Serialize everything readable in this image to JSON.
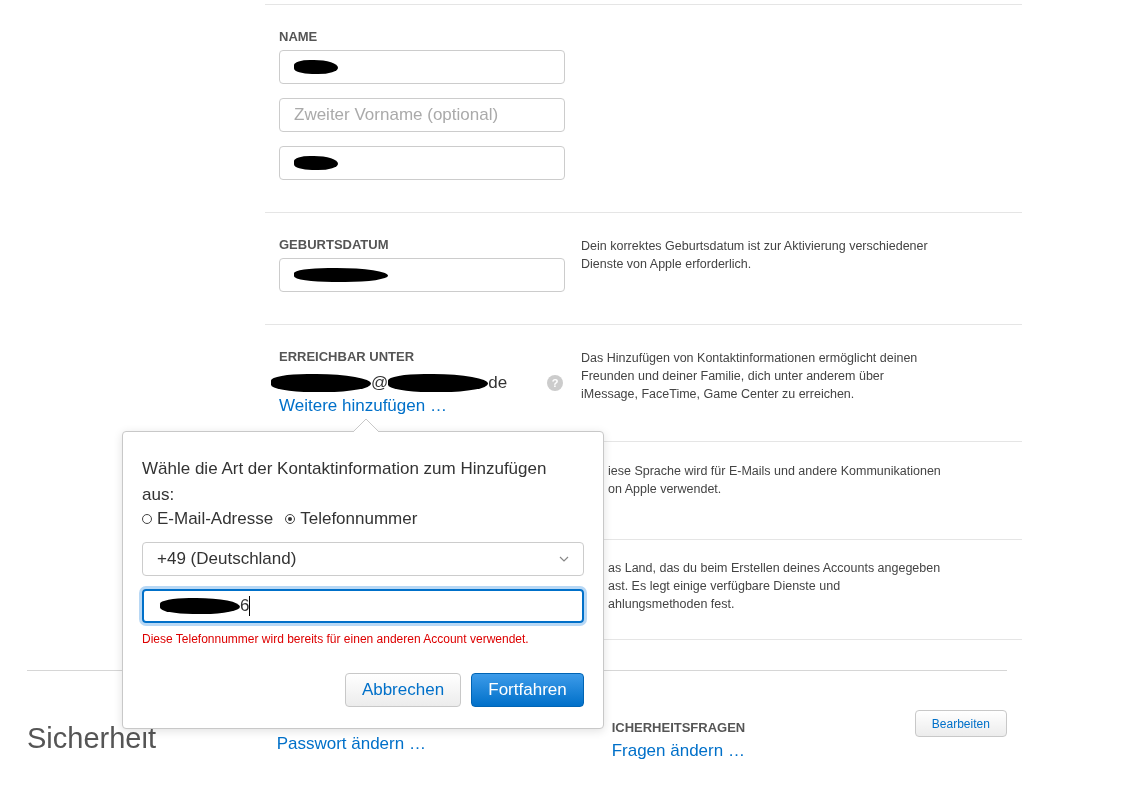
{
  "name_section": {
    "label": "NAME",
    "fields": [
      {
        "redacted": true
      },
      {
        "placeholder": "Zweiter Vorname (optional)",
        "redacted": false
      },
      {
        "redacted": true
      }
    ]
  },
  "birthdate_section": {
    "label": "GEBURTSDATUM",
    "field": {
      "redacted": true
    },
    "description": "Dein korrektes Geburtsdatum ist zur Aktivierung verschiedener Dienste von Apple erforderlich."
  },
  "reachable_section": {
    "label": "ERREICHBAR UNTER",
    "email_parts": [
      {
        "kind": "redacted"
      },
      {
        "kind": "text",
        "text": "@"
      },
      {
        "kind": "redacted"
      },
      {
        "kind": "text",
        "text": "de"
      }
    ],
    "help": "?",
    "add_link": "Weitere hinzufügen …",
    "description": "Das Hinzufügen von Kontaktinformationen ermöglicht deinen Freunden und deiner Familie, dich unter anderem über iMessage, FaceTime, Game Center zu erreichen."
  },
  "language_section": {
    "description_lines": [
      "iese Sprache wird für E-Mails und andere Kommunikationen",
      "on Apple verwendet."
    ]
  },
  "country_section": {
    "description_lines": [
      "as Land, das du beim Erstellen deines Accounts angegeben",
      "ast. Es legt einige verfügbare Dienste und",
      "ahlungsmethoden fest."
    ]
  },
  "security_section": {
    "title": "Sicherheit",
    "password_link": "Passwort ändern …",
    "questions_heading": "ICHERHEITSFRAGEN",
    "questions_link": "Fragen ändern …",
    "edit_button": "Bearbeiten"
  },
  "popover": {
    "prompt": "Wähle die Art der Kontaktinformation zum Hinzufügen aus:",
    "options": [
      {
        "label": "E-Mail-Adresse",
        "selected": false
      },
      {
        "label": "Telefonnummer",
        "selected": true
      }
    ],
    "country_select": "+49 (Deutschland)",
    "phone_parts": [
      {
        "kind": "redacted"
      },
      {
        "kind": "text",
        "text": "6"
      }
    ],
    "error": "Diese Telefonnummer wird bereits für einen anderen Account verwendet.",
    "cancel_button": "Abbrechen",
    "continue_button": "Fortfahren"
  }
}
